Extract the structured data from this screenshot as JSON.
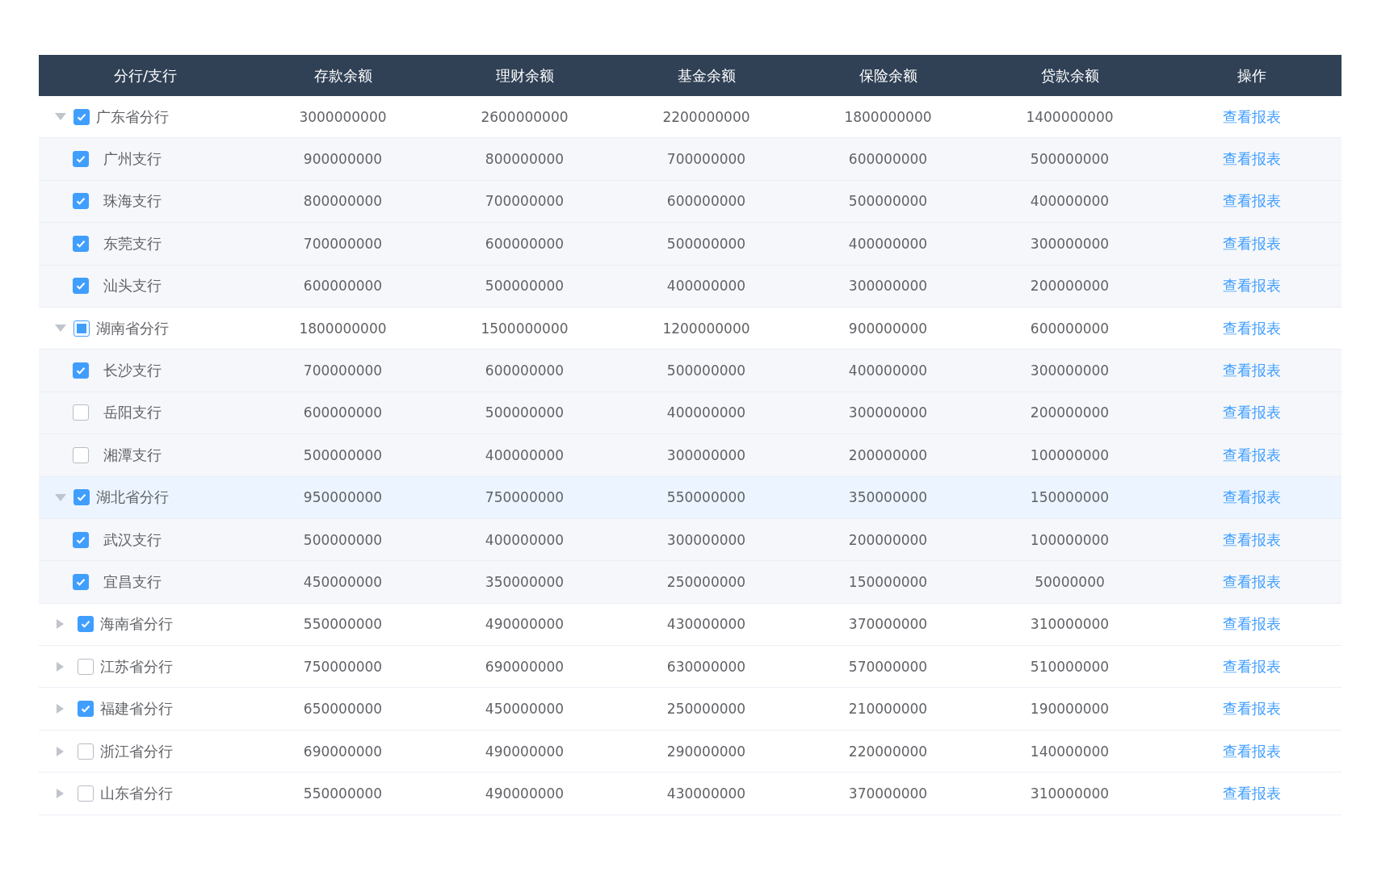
{
  "table": {
    "columns": [
      "分行/支行",
      "存款余额",
      "理财余额",
      "基金余额",
      "保险余额",
      "贷款余额",
      "操作"
    ],
    "rows": [
      {
        "name": "广东省分行",
        "values": [
          "3000000000",
          "2600000000",
          "2200000000",
          "1800000000",
          "1400000000"
        ],
        "action": "查看报表",
        "checked": true,
        "indeterminate": false,
        "expanded": true,
        "highlighted": false,
        "children": [
          {
            "name": "广州支行",
            "values": [
              "900000000",
              "800000000",
              "700000000",
              "600000000",
              "500000000"
            ],
            "action": "查看报表",
            "checked": true,
            "indeterminate": false,
            "highlighted": false
          },
          {
            "name": "珠海支行",
            "values": [
              "800000000",
              "700000000",
              "600000000",
              "500000000",
              "400000000"
            ],
            "action": "查看报表",
            "checked": true,
            "indeterminate": false,
            "highlighted": false
          },
          {
            "name": "东莞支行",
            "values": [
              "700000000",
              "600000000",
              "500000000",
              "400000000",
              "300000000"
            ],
            "action": "查看报表",
            "checked": true,
            "indeterminate": false,
            "highlighted": false
          },
          {
            "name": "汕头支行",
            "values": [
              "600000000",
              "500000000",
              "400000000",
              "300000000",
              "200000000"
            ],
            "action": "查看报表",
            "checked": true,
            "indeterminate": false,
            "highlighted": false
          }
        ]
      },
      {
        "name": "湖南省分行",
        "values": [
          "1800000000",
          "1500000000",
          "1200000000",
          "900000000",
          "600000000"
        ],
        "action": "查看报表",
        "checked": false,
        "indeterminate": true,
        "expanded": true,
        "highlighted": false,
        "children": [
          {
            "name": "长沙支行",
            "values": [
              "700000000",
              "600000000",
              "500000000",
              "400000000",
              "300000000"
            ],
            "action": "查看报表",
            "checked": true,
            "indeterminate": false,
            "highlighted": false
          },
          {
            "name": "岳阳支行",
            "values": [
              "600000000",
              "500000000",
              "400000000",
              "300000000",
              "200000000"
            ],
            "action": "查看报表",
            "checked": false,
            "indeterminate": false,
            "highlighted": false
          },
          {
            "name": "湘潭支行",
            "values": [
              "500000000",
              "400000000",
              "300000000",
              "200000000",
              "100000000"
            ],
            "action": "查看报表",
            "checked": false,
            "indeterminate": false,
            "highlighted": false
          }
        ]
      },
      {
        "name": "湖北省分行",
        "values": [
          "950000000",
          "750000000",
          "550000000",
          "350000000",
          "150000000"
        ],
        "action": "查看报表",
        "checked": true,
        "indeterminate": false,
        "expanded": true,
        "highlighted": true,
        "children": [
          {
            "name": "武汉支行",
            "values": [
              "500000000",
              "400000000",
              "300000000",
              "200000000",
              "100000000"
            ],
            "action": "查看报表",
            "checked": true,
            "indeterminate": false,
            "highlighted": false
          },
          {
            "name": "宜昌支行",
            "values": [
              "450000000",
              "350000000",
              "250000000",
              "150000000",
              "50000000"
            ],
            "action": "查看报表",
            "checked": true,
            "indeterminate": false,
            "highlighted": false
          }
        ]
      },
      {
        "name": "海南省分行",
        "values": [
          "550000000",
          "490000000",
          "430000000",
          "370000000",
          "310000000"
        ],
        "action": "查看报表",
        "checked": true,
        "indeterminate": false,
        "expanded": false,
        "highlighted": false
      },
      {
        "name": "江苏省分行",
        "values": [
          "750000000",
          "690000000",
          "630000000",
          "570000000",
          "510000000"
        ],
        "action": "查看报表",
        "checked": false,
        "indeterminate": false,
        "expanded": false,
        "highlighted": false
      },
      {
        "name": "福建省分行",
        "values": [
          "650000000",
          "450000000",
          "250000000",
          "210000000",
          "190000000"
        ],
        "action": "查看报表",
        "checked": true,
        "indeterminate": false,
        "expanded": false,
        "highlighted": false
      },
      {
        "name": "浙江省分行",
        "values": [
          "690000000",
          "490000000",
          "290000000",
          "220000000",
          "140000000"
        ],
        "action": "查看报表",
        "checked": false,
        "indeterminate": false,
        "expanded": false,
        "highlighted": false
      },
      {
        "name": "山东省分行",
        "values": [
          "550000000",
          "490000000",
          "430000000",
          "370000000",
          "310000000"
        ],
        "action": "查看报表",
        "checked": false,
        "indeterminate": false,
        "expanded": false,
        "highlighted": false
      }
    ]
  }
}
